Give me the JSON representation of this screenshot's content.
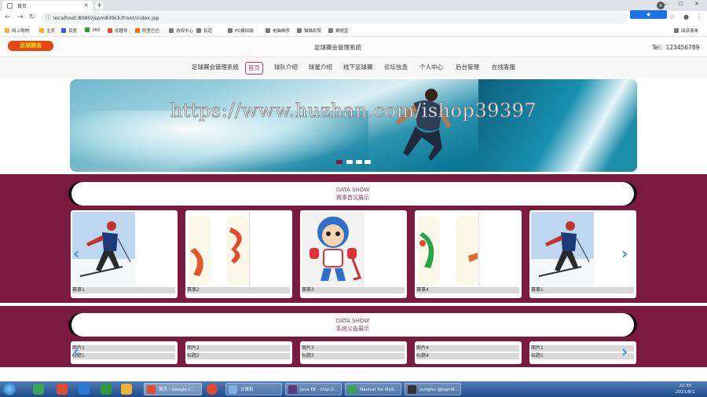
{
  "browser": {
    "tab_title": "首页",
    "tab_close": "×",
    "new_tab": "+",
    "url": "localhost:8080/jspm839ck/front/index.jsp",
    "translate_button": "",
    "bookmarks": [
      "网上购物",
      "主页",
      "百度",
      "360",
      "优趣导",
      "阿里巴巴",
      "游戏中心",
      "有道",
      "PC模拟端",
      "电脑维修",
      "猫猫影院",
      "聚便宜"
    ],
    "reading_list": "阅读清单",
    "window_controls": "— ☐ ✕"
  },
  "site": {
    "logo_text": "足球赛会",
    "title": "足球赛会管理系统",
    "tel": "Tel：123456789",
    "nav": [
      "足球赛会管理系统",
      "首页",
      "球队介绍",
      "球星介绍",
      "线下足球赛",
      "论坛信息",
      "个人中心",
      "后台管理",
      "在线客服"
    ],
    "nav_active_index": 1
  },
  "banner": {
    "watermark": "https://www.huzhan.com/ishop39397",
    "slides": 4,
    "active_slide": 0
  },
  "events_section": {
    "heading": "DATA SHOW",
    "subheading": "赛事首况展示",
    "cards": [
      {
        "label": "赛事1",
        "image": "skier"
      },
      {
        "label": "赛事2",
        "image": "ribbons"
      },
      {
        "label": "赛事3",
        "image": "hockey-mascot"
      },
      {
        "label": "赛事4",
        "image": "ribbons-green"
      },
      {
        "label": "赛事1",
        "image": "skier"
      }
    ],
    "prev_arrow": "‹",
    "next_arrow": "›"
  },
  "notice_section": {
    "heading": "DATA SHOW",
    "subheading": "系统公告展示",
    "cards": [
      {
        "line1": "图片1",
        "line2": "标题1"
      },
      {
        "line1": "图片2",
        "line2": "标题2"
      },
      {
        "line1": "图片3",
        "line2": "标题3"
      },
      {
        "line1": "图片4",
        "line2": "标题4"
      },
      {
        "line1": "图片1",
        "line2": "标题1"
      }
    ],
    "prev_arrow": "‹",
    "next_arrow": "›"
  },
  "taskbar": {
    "tasks": [
      "首页 - Google C...",
      "计算机",
      "Java EE - http://...",
      "Navicat for MyS...",
      "yunghu @jspm8..."
    ],
    "time": "22:35",
    "date": "2021/8/1"
  },
  "colors": {
    "accent": "#7a1a3e",
    "nav_active": "#c0345f",
    "arrow": "#3a8fd8"
  }
}
